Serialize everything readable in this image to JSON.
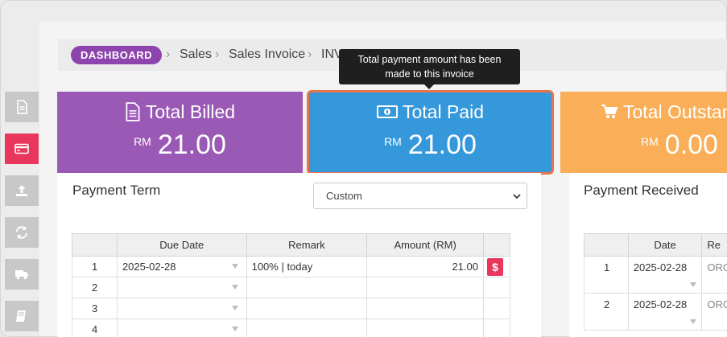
{
  "breadcrumb": {
    "dashboard": "DASHBOARD",
    "items": [
      "Sales",
      "Sales Invoice",
      "INV"
    ]
  },
  "tooltip": {
    "line1": "Total payment amount has been",
    "line2": "made to this invoice"
  },
  "sidebar": {
    "items": [
      {
        "icon": "document-icon",
        "active": false
      },
      {
        "icon": "credit-card-icon",
        "active": true
      },
      {
        "icon": "upload-icon",
        "active": false
      },
      {
        "icon": "refresh-icon",
        "active": false
      },
      {
        "icon": "truck-icon",
        "active": false
      },
      {
        "icon": "book-icon",
        "active": false
      }
    ]
  },
  "cards": {
    "billed": {
      "title": "Total Billed",
      "currency": "RM",
      "value": "21.00",
      "color": "#9b59b6"
    },
    "paid": {
      "title": "Total Paid",
      "currency": "RM",
      "value": "21.00",
      "color": "#3498db"
    },
    "outstanding": {
      "title": "Total Outstan",
      "currency": "RM",
      "value": "0.00",
      "color": "#f9ae57"
    }
  },
  "payment_term": {
    "title": "Payment Term",
    "select_value": "Custom",
    "columns": [
      "",
      "Due Date",
      "Remark",
      "Amount (RM)",
      ""
    ],
    "rows": [
      {
        "no": "1",
        "due_date": "2025-02-28",
        "remark": "100% |  today",
        "amount": "21.00",
        "pay": "$"
      },
      {
        "no": "2",
        "due_date": "",
        "remark": "",
        "amount": "",
        "pay": ""
      },
      {
        "no": "3",
        "due_date": "",
        "remark": "",
        "amount": "",
        "pay": ""
      },
      {
        "no": "4",
        "due_date": "",
        "remark": "",
        "amount": "",
        "pay": ""
      }
    ]
  },
  "payment_received": {
    "title": "Payment Received",
    "columns": [
      "",
      "Date",
      "Re"
    ],
    "rows": [
      {
        "no": "1",
        "date": "2025-02-28",
        "ref": "ORG"
      },
      {
        "no": "2",
        "date": "2025-02-28",
        "ref": "ORG"
      }
    ]
  }
}
